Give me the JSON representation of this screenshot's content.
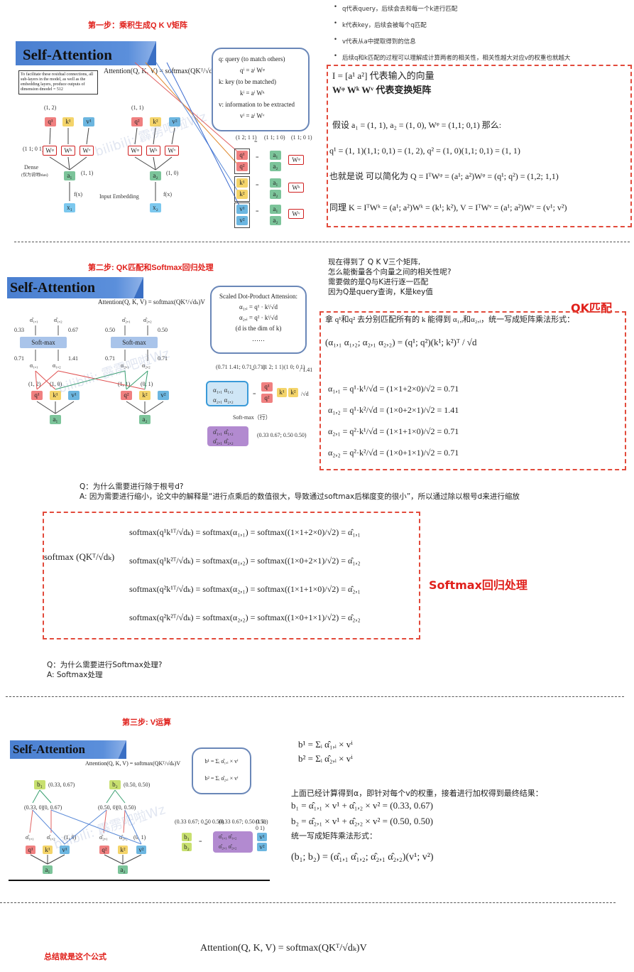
{
  "step1": {
    "title": "第一步：乘积生成Q K V矩阵",
    "banner": "Self-Attention",
    "formula": "Attention(Q, K, V) = softmax(QKᵀ/√dₖ)V",
    "note": "To facilitate these residual connections, all sub-layers in the model, as well as the embedding layers, produce outputs of dimension dmodel = 512",
    "dense_label": "Dense",
    "dense_sub": "(仅为说明bias)",
    "input_embedding": "Input Embedding",
    "bubble": [
      "q: query (to match others)",
      "qⁱ = aⁱ Wᵠ",
      "k: key (to be matched)",
      "kⁱ = aⁱ Wᵏ",
      "v: information to be extracted",
      "vⁱ = aⁱ Wᵛ"
    ],
    "bullets": [
      "q代表query，后续会去和每一个k进行匹配",
      "k代表key，后续会被每个q匹配",
      "v代表从a中提取得到的信息",
      "后续q和k匹配的过程可以理解成计算两者的相关性，相关性越大对应v的权重也就越大"
    ],
    "box_lines": [
      "I = [a¹  a²] 代表输入的向量",
      "Wᵠ   Wᵏ   Wᵛ 代表变换矩阵",
      "假设 a₁ = (1, 1), a₂ = (1, 0), Wᵠ = (1,1; 0,1) 那么:",
      "q¹ = (1, 1)(1,1; 0,1) = (1, 2),    q² = (1, 0)(1,1; 0,1) = (1, 1)",
      "也就是说 可以简化为 Q = IᵀWᵠ = (a¹; a²)Wᵠ = (q¹; q²) = (1,2; 1,1)",
      "同理 K = IᵀWᵏ = (a¹; a²)Wᵏ = (k¹; k²),  V = IᵀWᵛ = (a¹; a²)Wᵛ = (v¹; v²)"
    ]
  },
  "step2": {
    "title": "第二步: QK匹配和Softmax回归处理",
    "banner": "Self-Attention",
    "softmax_label": "Soft-max",
    "bubble_title": "Scaled Dot-Product Attension:",
    "bubble_lines": [
      "α₁,ᵢ = q¹ · kⁱ/√d",
      "α₂,ᵢ = q² · kⁱ/√d",
      "(d is the dim of k)",
      "……"
    ],
    "softmax_row": "Soft-max（行）",
    "intro": [
      "现在得到了 Q K V三个矩阵,",
      "怎么能衡量各个向量之间的相关性呢?",
      "需要做的是Q与K进行逐一匹配",
      "因为Q是query查询，K是key值"
    ],
    "qk_label": "QK匹配",
    "qk_line": "拿 q¹和q² 去分别匹配所有的 k 能得到 α₁,ᵢ和α₂,ᵢ，统一写成矩阵乘法形式：",
    "alpha_lines": [
      "α₁,₁ = q¹·k¹/√d = (1×1+2×0)/√2 = 0.71",
      "α₁,₂ = q¹·k²/√d = (1×0+2×1)/√2 = 1.41",
      "α₂,₁ = q²·k¹/√d = (1×1+1×0)/√2 = 0.71",
      "α₂,₂ = q²·k²/√d = (1×0+1×1)/√2 = 0.71"
    ],
    "question1": "Q：为什么需要进行除于根号d?",
    "answer1": "A: 因为需要进行缩小，论文中的解释是“进行点乘后的数值很大，导致通过softmax后梯度变的很小”，所以通过除以根号d来进行缩放",
    "softmax_left": "softmax (QKᵀ/√dₖ)",
    "softmax_lines": [
      "softmax(q¹k¹ᵀ/√dₖ) = softmax(α₁,₁) = softmax((1×1+2×0)/√2) = α̂₁,₁",
      "softmax(q¹k²ᵀ/√dₖ) = softmax(α₁,₂) = softmax((1×0+2×1)/√2) = α̂₁,₂",
      "softmax(q²k¹ᵀ/√dₖ) = softmax(α₂,₁) = softmax((1×1+1×0)/√2) = α̂₂,₁",
      "softmax(q²k²ᵀ/√dₖ) = softmax(α₂,₂) = softmax((1×0+1×1)/√2) = α̂₂,₂"
    ],
    "softmax_label_red": "Softmax回归处理",
    "question2": "Q：为什么需要进行Softmax处理?",
    "answer2": "A: Softmax处理"
  },
  "step3": {
    "title": "第三步: V运算",
    "banner": "Self-Attention",
    "b_defs": [
      "b¹ = Σᵢ α̂₁,ᵢ × vⁱ",
      "b² = Σᵢ α̂₂,ᵢ × vⁱ"
    ],
    "desc": "上面已经计算得到α，即针对每个v的权重，接着进行加权得到最终结果：",
    "b_lines": [
      "b₁   = α̂₁,₁ × v¹ + α̂₁,₂ × v²    = (0.33, 0.67)",
      "b₂   = α̂₂,₁ × v¹ + α̂₂,₂ × v²    = (0.50, 0.50)"
    ],
    "unify": "统一写成矩阵乘法形式：",
    "matrix": "(b₁; b₂) = (α̂₁,₁  α̂₁,₂; α̂₂,₁  α̂₂,₂)(v¹; v²)",
    "b1_val": "(0.33, 0.67)",
    "b2_val": "(0.50, 0.50)"
  },
  "summary": {
    "label": "总结就是这个公式",
    "formula": "Attention(Q, K, V) = softmax(QKᵀ/√dₖ)V"
  },
  "watermark": "bilibili: 霹雳吧啦Wz"
}
